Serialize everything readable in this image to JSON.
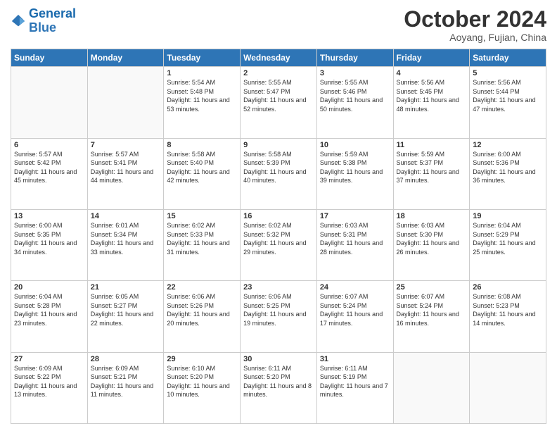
{
  "header": {
    "logo_general": "General",
    "logo_blue": "Blue",
    "month_title": "October 2024",
    "location": "Aoyang, Fujian, China"
  },
  "weekdays": [
    "Sunday",
    "Monday",
    "Tuesday",
    "Wednesday",
    "Thursday",
    "Friday",
    "Saturday"
  ],
  "weeks": [
    [
      {
        "day": "",
        "info": ""
      },
      {
        "day": "",
        "info": ""
      },
      {
        "day": "1",
        "info": "Sunrise: 5:54 AM\nSunset: 5:48 PM\nDaylight: 11 hours and 53 minutes."
      },
      {
        "day": "2",
        "info": "Sunrise: 5:55 AM\nSunset: 5:47 PM\nDaylight: 11 hours and 52 minutes."
      },
      {
        "day": "3",
        "info": "Sunrise: 5:55 AM\nSunset: 5:46 PM\nDaylight: 11 hours and 50 minutes."
      },
      {
        "day": "4",
        "info": "Sunrise: 5:56 AM\nSunset: 5:45 PM\nDaylight: 11 hours and 48 minutes."
      },
      {
        "day": "5",
        "info": "Sunrise: 5:56 AM\nSunset: 5:44 PM\nDaylight: 11 hours and 47 minutes."
      }
    ],
    [
      {
        "day": "6",
        "info": "Sunrise: 5:57 AM\nSunset: 5:42 PM\nDaylight: 11 hours and 45 minutes."
      },
      {
        "day": "7",
        "info": "Sunrise: 5:57 AM\nSunset: 5:41 PM\nDaylight: 11 hours and 44 minutes."
      },
      {
        "day": "8",
        "info": "Sunrise: 5:58 AM\nSunset: 5:40 PM\nDaylight: 11 hours and 42 minutes."
      },
      {
        "day": "9",
        "info": "Sunrise: 5:58 AM\nSunset: 5:39 PM\nDaylight: 11 hours and 40 minutes."
      },
      {
        "day": "10",
        "info": "Sunrise: 5:59 AM\nSunset: 5:38 PM\nDaylight: 11 hours and 39 minutes."
      },
      {
        "day": "11",
        "info": "Sunrise: 5:59 AM\nSunset: 5:37 PM\nDaylight: 11 hours and 37 minutes."
      },
      {
        "day": "12",
        "info": "Sunrise: 6:00 AM\nSunset: 5:36 PM\nDaylight: 11 hours and 36 minutes."
      }
    ],
    [
      {
        "day": "13",
        "info": "Sunrise: 6:00 AM\nSunset: 5:35 PM\nDaylight: 11 hours and 34 minutes."
      },
      {
        "day": "14",
        "info": "Sunrise: 6:01 AM\nSunset: 5:34 PM\nDaylight: 11 hours and 33 minutes."
      },
      {
        "day": "15",
        "info": "Sunrise: 6:02 AM\nSunset: 5:33 PM\nDaylight: 11 hours and 31 minutes."
      },
      {
        "day": "16",
        "info": "Sunrise: 6:02 AM\nSunset: 5:32 PM\nDaylight: 11 hours and 29 minutes."
      },
      {
        "day": "17",
        "info": "Sunrise: 6:03 AM\nSunset: 5:31 PM\nDaylight: 11 hours and 28 minutes."
      },
      {
        "day": "18",
        "info": "Sunrise: 6:03 AM\nSunset: 5:30 PM\nDaylight: 11 hours and 26 minutes."
      },
      {
        "day": "19",
        "info": "Sunrise: 6:04 AM\nSunset: 5:29 PM\nDaylight: 11 hours and 25 minutes."
      }
    ],
    [
      {
        "day": "20",
        "info": "Sunrise: 6:04 AM\nSunset: 5:28 PM\nDaylight: 11 hours and 23 minutes."
      },
      {
        "day": "21",
        "info": "Sunrise: 6:05 AM\nSunset: 5:27 PM\nDaylight: 11 hours and 22 minutes."
      },
      {
        "day": "22",
        "info": "Sunrise: 6:06 AM\nSunset: 5:26 PM\nDaylight: 11 hours and 20 minutes."
      },
      {
        "day": "23",
        "info": "Sunrise: 6:06 AM\nSunset: 5:25 PM\nDaylight: 11 hours and 19 minutes."
      },
      {
        "day": "24",
        "info": "Sunrise: 6:07 AM\nSunset: 5:24 PM\nDaylight: 11 hours and 17 minutes."
      },
      {
        "day": "25",
        "info": "Sunrise: 6:07 AM\nSunset: 5:24 PM\nDaylight: 11 hours and 16 minutes."
      },
      {
        "day": "26",
        "info": "Sunrise: 6:08 AM\nSunset: 5:23 PM\nDaylight: 11 hours and 14 minutes."
      }
    ],
    [
      {
        "day": "27",
        "info": "Sunrise: 6:09 AM\nSunset: 5:22 PM\nDaylight: 11 hours and 13 minutes."
      },
      {
        "day": "28",
        "info": "Sunrise: 6:09 AM\nSunset: 5:21 PM\nDaylight: 11 hours and 11 minutes."
      },
      {
        "day": "29",
        "info": "Sunrise: 6:10 AM\nSunset: 5:20 PM\nDaylight: 11 hours and 10 minutes."
      },
      {
        "day": "30",
        "info": "Sunrise: 6:11 AM\nSunset: 5:20 PM\nDaylight: 11 hours and 8 minutes."
      },
      {
        "day": "31",
        "info": "Sunrise: 6:11 AM\nSunset: 5:19 PM\nDaylight: 11 hours and 7 minutes."
      },
      {
        "day": "",
        "info": ""
      },
      {
        "day": "",
        "info": ""
      }
    ]
  ]
}
